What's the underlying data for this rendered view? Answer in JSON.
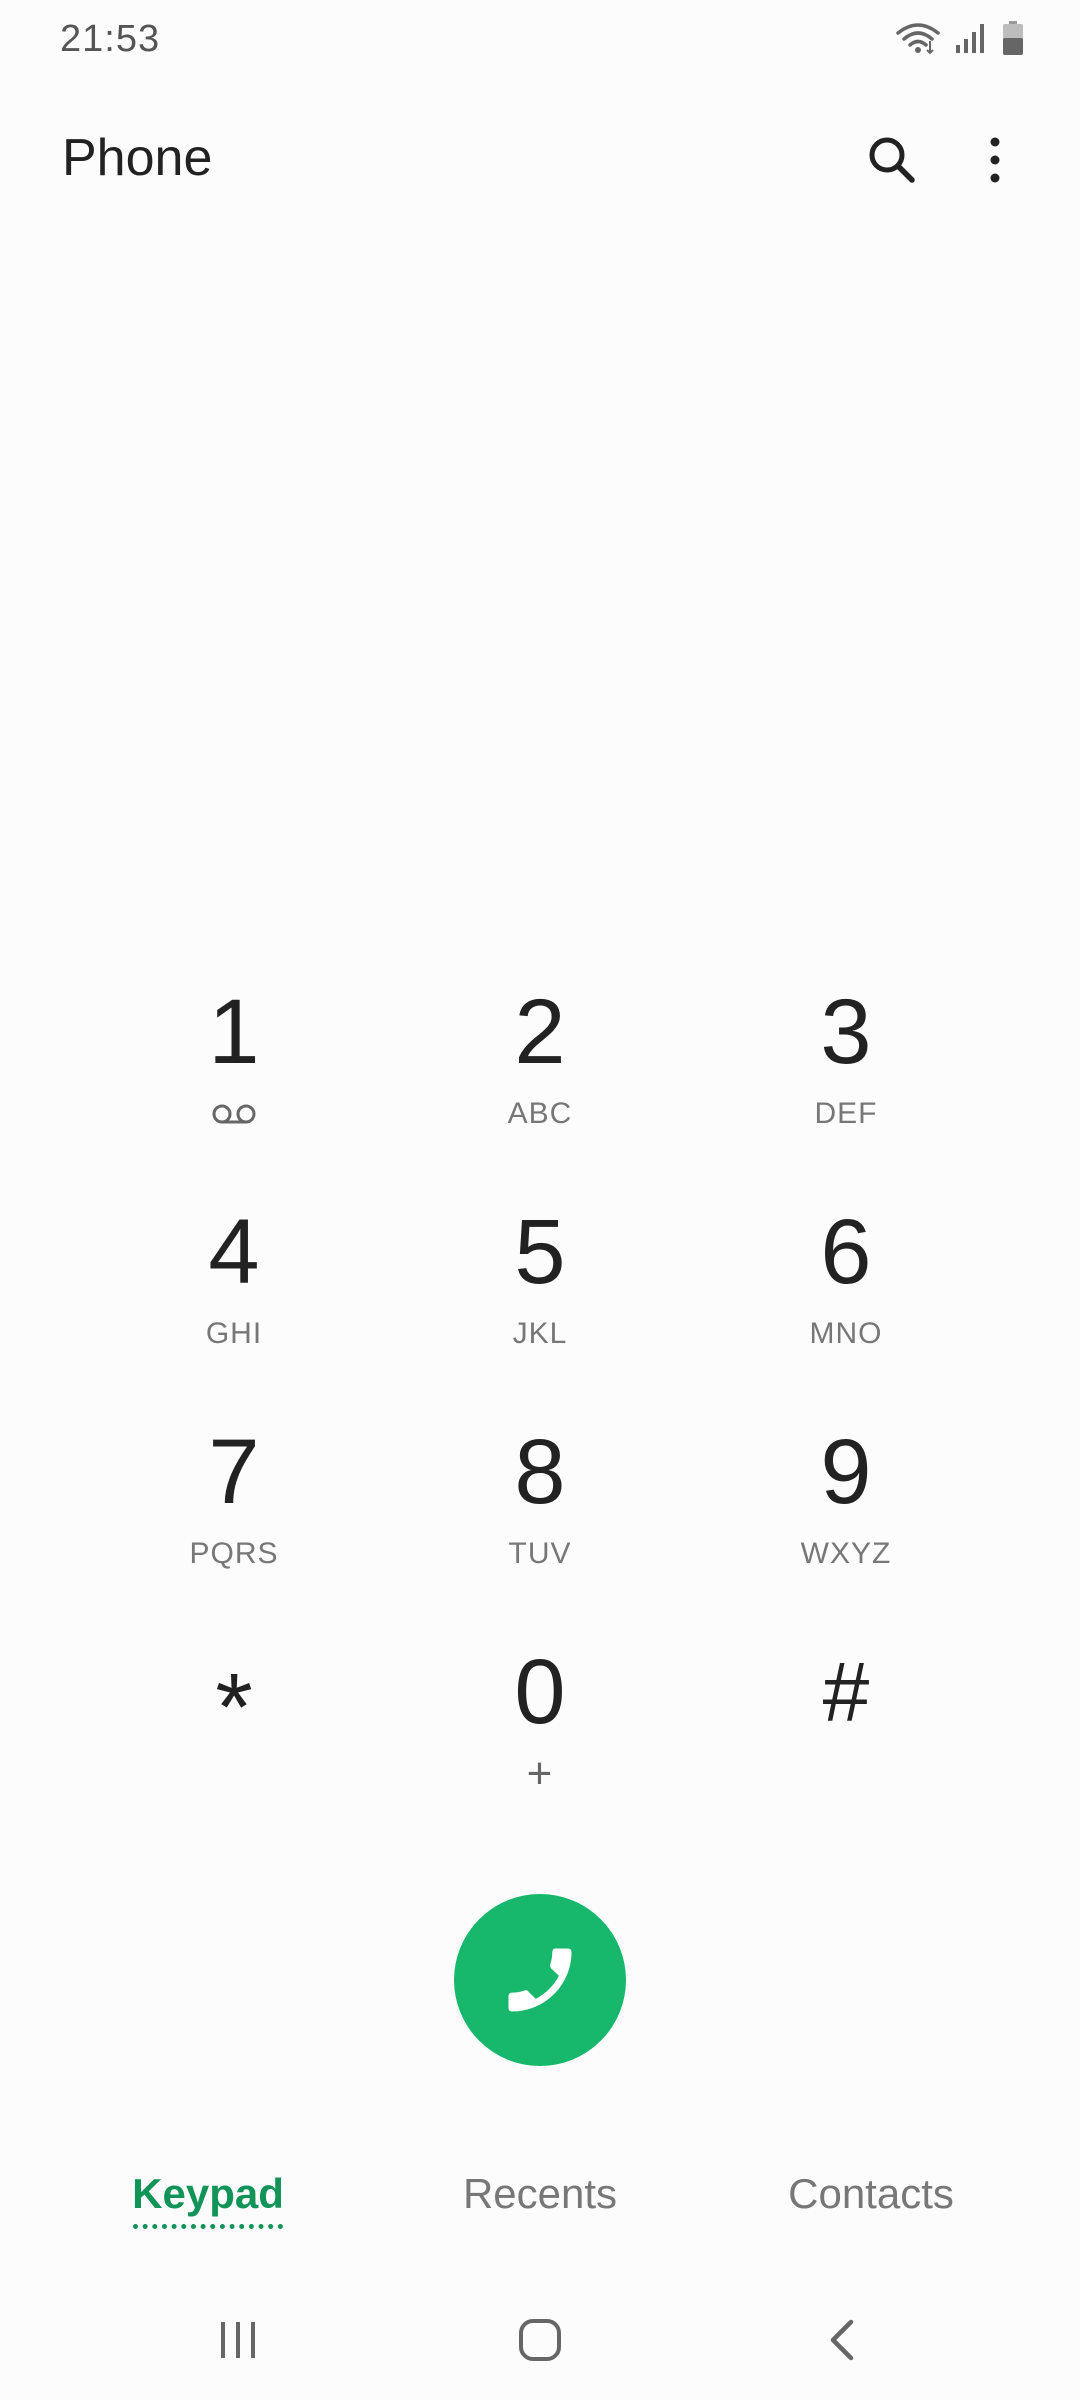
{
  "status_bar": {
    "time": "21:53",
    "icons": [
      "wifi-icon",
      "signal-icon",
      "battery-icon"
    ]
  },
  "app_bar": {
    "title": "Phone",
    "actions": [
      "search-icon",
      "more-options-icon"
    ]
  },
  "keypad": {
    "keys": [
      {
        "digit": "1",
        "sub": "",
        "sub_icon": "voicemail-icon"
      },
      {
        "digit": "2",
        "sub": "ABC"
      },
      {
        "digit": "3",
        "sub": "DEF"
      },
      {
        "digit": "4",
        "sub": "GHI"
      },
      {
        "digit": "5",
        "sub": "JKL"
      },
      {
        "digit": "6",
        "sub": "MNO"
      },
      {
        "digit": "7",
        "sub": "PQRS"
      },
      {
        "digit": "8",
        "sub": "TUV"
      },
      {
        "digit": "9",
        "sub": "WXYZ"
      },
      {
        "digit": "*",
        "sub": ""
      },
      {
        "digit": "0",
        "sub": "+"
      },
      {
        "digit": "#",
        "sub": ""
      }
    ]
  },
  "call_button": {
    "icon": "phone-icon",
    "color": "#17b86b"
  },
  "tabs": {
    "items": [
      {
        "label": "Keypad",
        "active": true
      },
      {
        "label": "Recents",
        "active": false
      },
      {
        "label": "Contacts",
        "active": false
      }
    ],
    "active_color": "#129358"
  },
  "nav_bar": {
    "buttons": [
      "recent-apps-icon",
      "home-icon",
      "back-icon"
    ]
  }
}
